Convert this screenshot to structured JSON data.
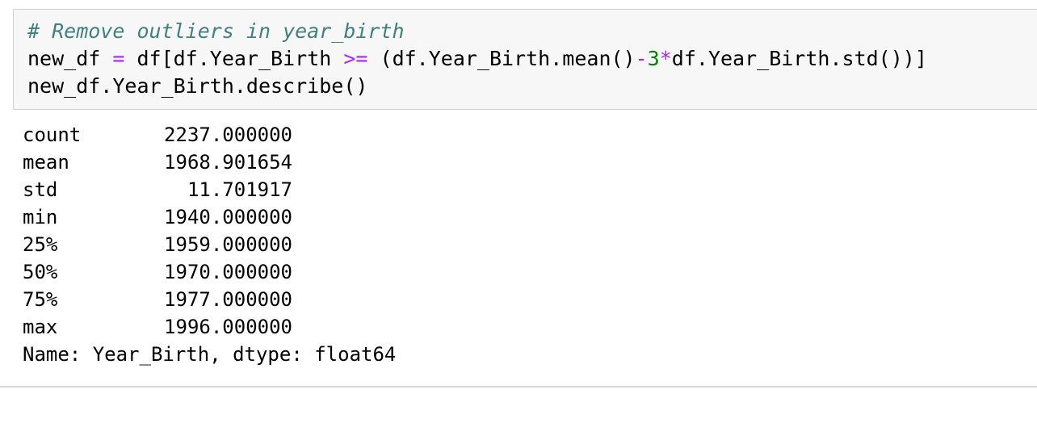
{
  "input_cell": {
    "comment": "# Remove outliers in year_birth",
    "line2": {
      "part1": "new_df ",
      "op_eq": "=",
      "part2": " df[df.Year_Birth ",
      "op_ge": ">=",
      "part3": " (df.Year_Birth.mean()",
      "op_minus": "-",
      "num_3": "3",
      "op_mul": "*",
      "part4": "df.Year_Birth.std())]"
    },
    "line3": "new_df.Year_Birth.describe()"
  },
  "output": {
    "rows": [
      {
        "label": "count",
        "value": "2237.000000"
      },
      {
        "label": "mean",
        "value": "1968.901654"
      },
      {
        "label": "std",
        "value": "11.701917"
      },
      {
        "label": "min",
        "value": "1940.000000"
      },
      {
        "label": "25%",
        "value": "1959.000000"
      },
      {
        "label": "50%",
        "value": "1970.000000"
      },
      {
        "label": "75%",
        "value": "1977.000000"
      },
      {
        "label": "max",
        "value": "1996.000000"
      }
    ],
    "footer": "Name: Year_Birth, dtype: float64"
  },
  "colors": {
    "cell_background": "#f7f7f7",
    "cell_border": "#cfcfcf",
    "comment": "#408080",
    "operator": "#aa22ff",
    "number": "#008000"
  }
}
